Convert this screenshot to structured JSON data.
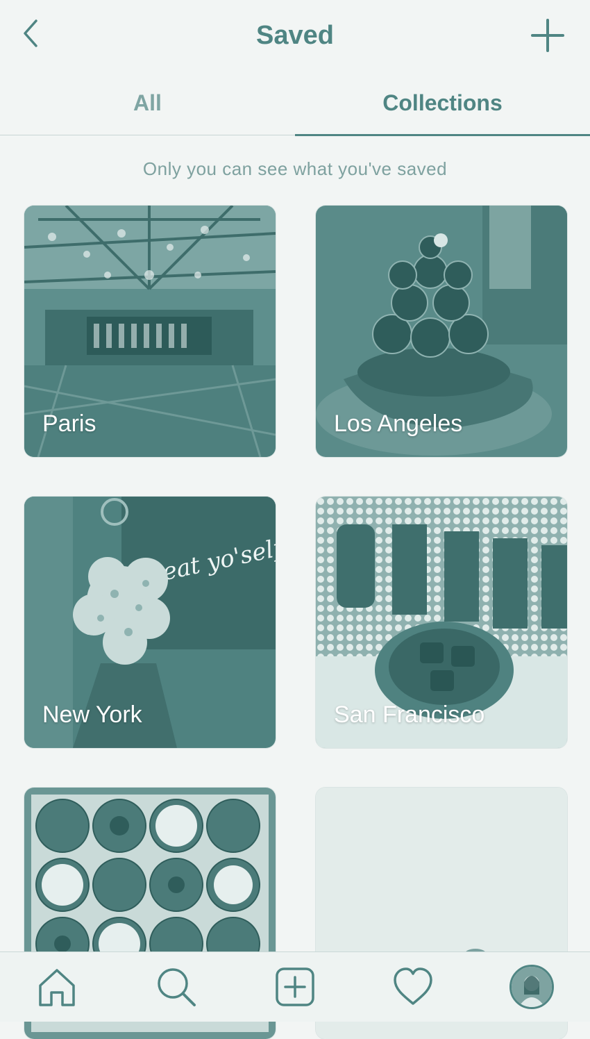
{
  "header": {
    "title": "Saved",
    "back_icon": "chevron-left-icon",
    "add_icon": "plus-icon"
  },
  "tabs": [
    {
      "label": "All",
      "active": false
    },
    {
      "label": "Collections",
      "active": true
    }
  ],
  "privacy_note": "Only you can see what you've saved",
  "collections": [
    {
      "name": "Paris"
    },
    {
      "name": "Los Angeles"
    },
    {
      "name": "New York"
    },
    {
      "name": "San Francisco"
    },
    {
      "name": ""
    },
    {
      "name": ""
    }
  ],
  "images": {
    "new_york_neon": "Treat yo'self"
  },
  "bottom_nav": [
    {
      "icon": "home-icon"
    },
    {
      "icon": "search-icon"
    },
    {
      "icon": "add-post-icon"
    },
    {
      "icon": "heart-icon"
    },
    {
      "icon": "profile-avatar"
    }
  ],
  "colors": {
    "accent": "#4f8583",
    "background": "#f2f5f4",
    "muted": "#7fa5a3"
  }
}
